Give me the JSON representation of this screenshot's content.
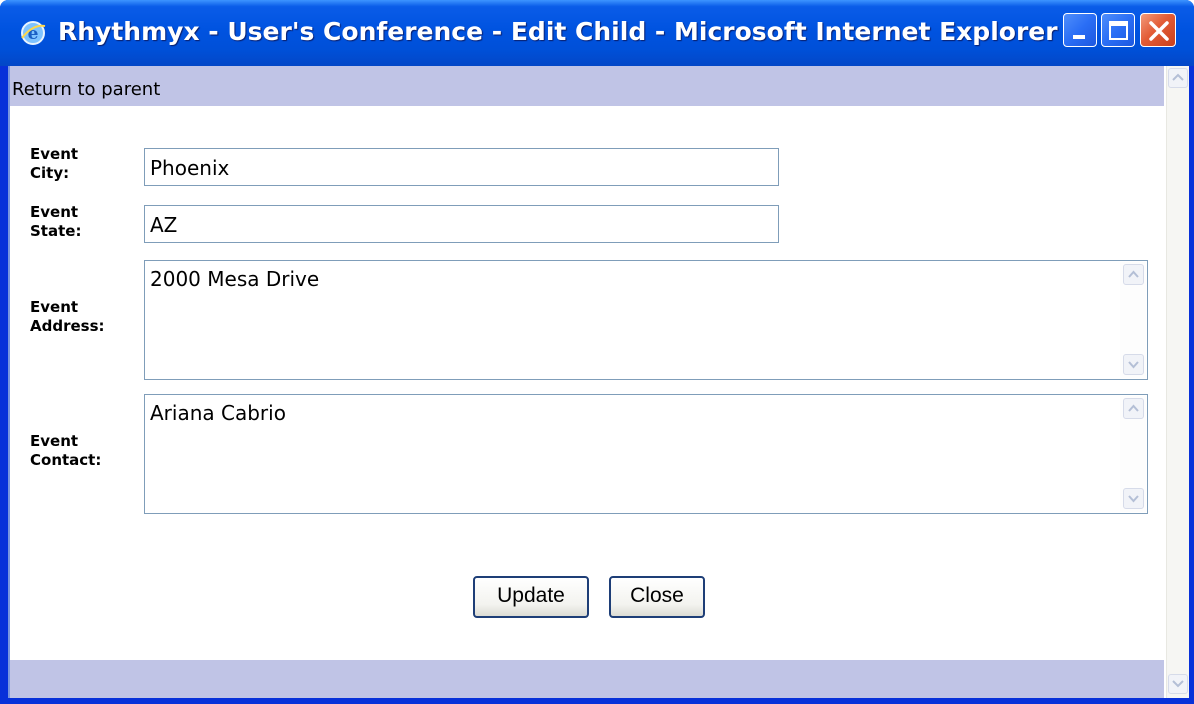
{
  "window": {
    "title": "Rhythmyx - User's Conference - Edit Child - Microsoft Internet Explorer",
    "title_icon": "ie-icon",
    "controls": [
      "minimize-icon",
      "maximize-icon",
      "close-icon"
    ]
  },
  "nav": {
    "return_label": "Return to parent"
  },
  "form": {
    "city": {
      "label_line1": "Event",
      "label_line2": "City:",
      "value": "Phoenix"
    },
    "state": {
      "label_line1": "Event",
      "label_line2": "State:",
      "value": "AZ"
    },
    "address": {
      "label_line1": "Event",
      "label_line2": "Address:",
      "value": "2000 Mesa Drive"
    },
    "contact": {
      "label_line1": "Event",
      "label_line2": "Contact:",
      "value": "Ariana Cabrio"
    }
  },
  "buttons": {
    "update_label": "Update",
    "close_label": "Close"
  },
  "colors": {
    "title_bar": "#0053e0",
    "page_bars": "#c0c4e6",
    "field_border": "#7f9db9",
    "close_button": "#e35c36"
  }
}
